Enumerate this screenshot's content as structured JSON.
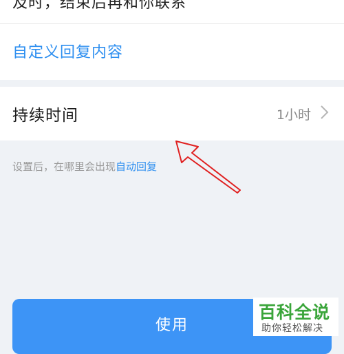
{
  "top_section": {
    "previous_reply_text": "及时，结束后再和你联系",
    "custom_reply_link": "自定义回复内容"
  },
  "duration_row": {
    "label": "持续时间",
    "value": "1小时",
    "chevron_icon": "chevron-right-icon"
  },
  "hint": {
    "text": "设置后，在哪里会出现",
    "link": "自动回复"
  },
  "use_button": {
    "label": "使用"
  },
  "watermark": {
    "title": "百科全说",
    "subtitle": "助你轻松解决"
  },
  "colors": {
    "accent": "#2e8ff0",
    "button": "#3d94f6",
    "background": "#eff2f6",
    "annotation_arrow": "#e02020",
    "watermark_green": "#3aa53a"
  }
}
